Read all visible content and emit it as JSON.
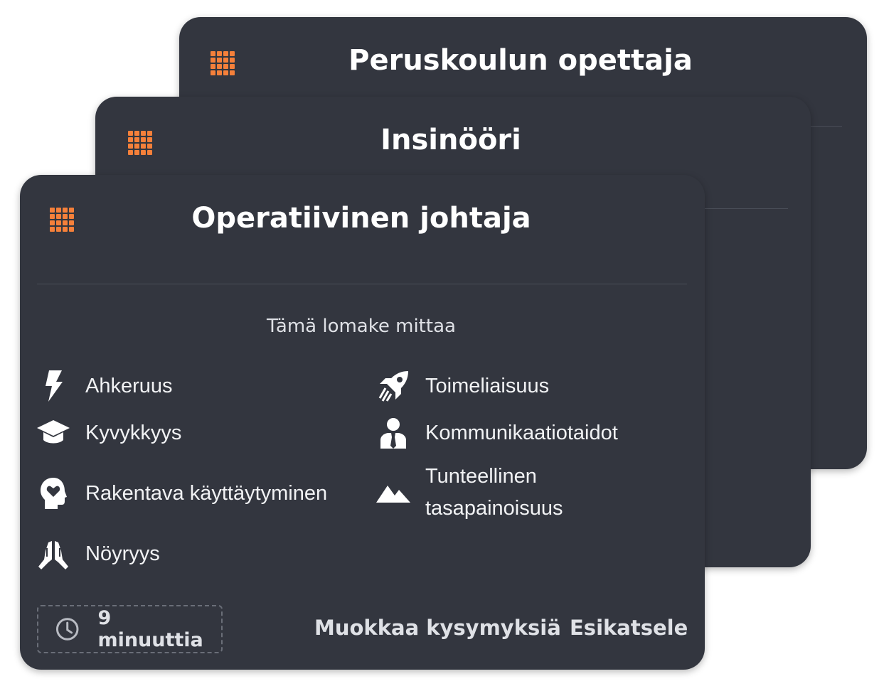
{
  "colors": {
    "card_bg": "#33363f",
    "accent": "#f5803a",
    "text": "#ffffff",
    "muted_text": "#dfe1e6"
  },
  "cards": {
    "back": {
      "title": "Peruskoulun opettaja",
      "icon": "grid-icon"
    },
    "middle": {
      "title": "Insinööri",
      "icon": "grid-icon"
    },
    "front": {
      "title": "Operatiivinen johtaja",
      "icon": "grid-icon",
      "subtitle": "Tämä lomake mittaa",
      "traits": [
        {
          "label": "Ahkeruus",
          "icon": "lightning-icon"
        },
        {
          "label": "Toimeliaisuus",
          "icon": "rocket-icon"
        },
        {
          "label": "Kyvykkyys",
          "icon": "graduation-cap-icon"
        },
        {
          "label": "Kommunikaatiotaidot",
          "icon": "user-tie-icon"
        },
        {
          "label": "Rakentava käyttäytyminen",
          "icon": "head-heart-icon"
        },
        {
          "label_line1": "Tunteellinen",
          "label_line2": "tasapainoisuus",
          "icon": "mountains-icon"
        },
        {
          "label": "Nöyryys",
          "icon": "praying-hands-icon"
        }
      ],
      "duration": {
        "text": "9 minuuttia",
        "icon": "clock-icon"
      },
      "actions": {
        "edit": "Muokkaa kysymyksiä",
        "preview": "Esikatsele"
      }
    }
  }
}
